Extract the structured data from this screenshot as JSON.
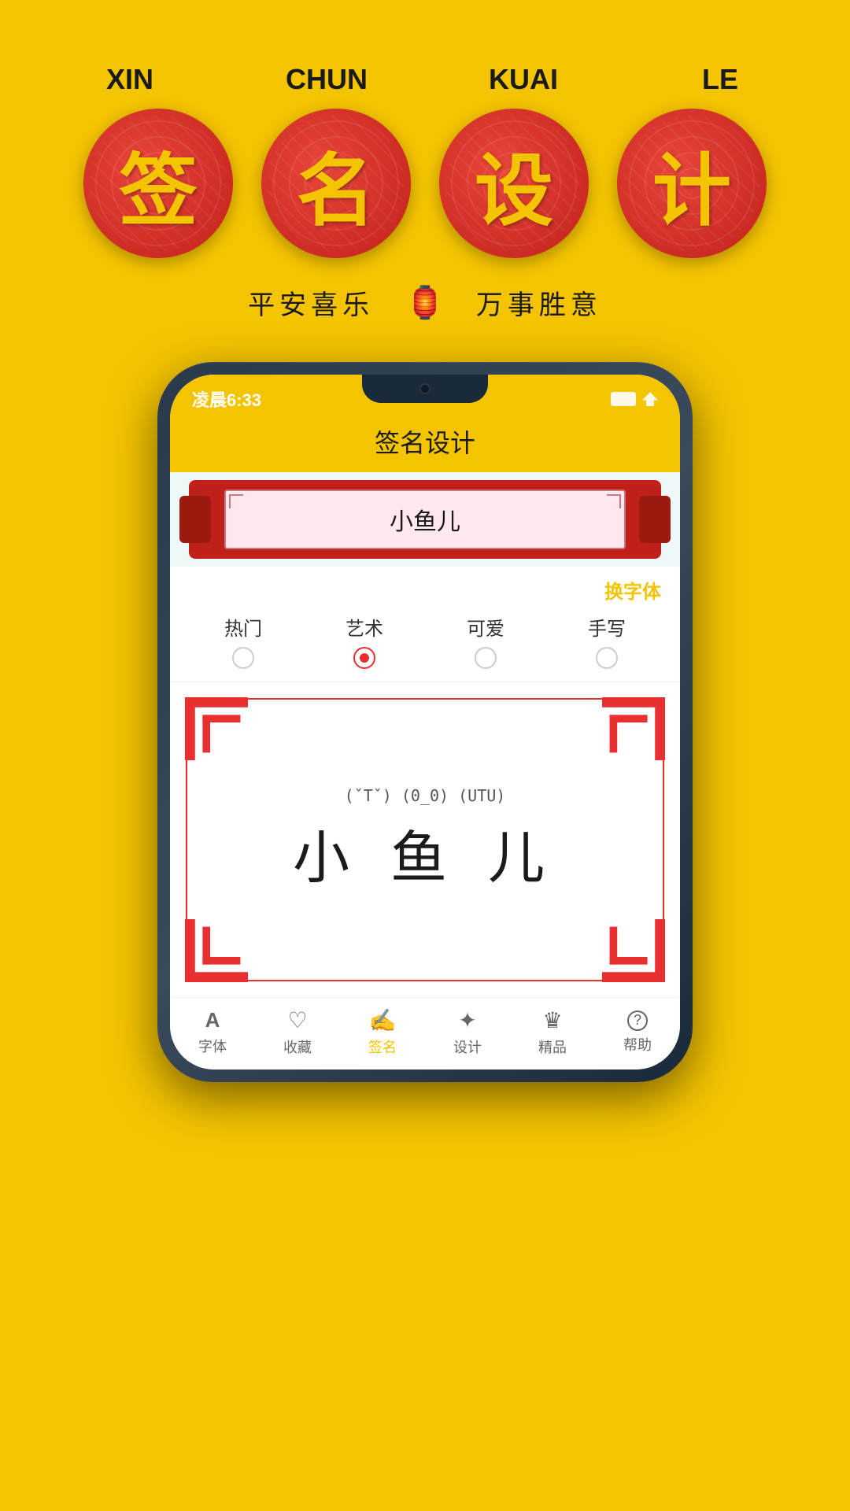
{
  "background_color": "#F5C400",
  "header": {
    "pinyin": [
      "XIN",
      "CHUN",
      "KUAI",
      "LE"
    ],
    "chars": [
      "签",
      "名",
      "设",
      "计"
    ],
    "subtitles": {
      "left": "平安喜乐",
      "right": "万事胜意",
      "icon": "🏮"
    }
  },
  "phone": {
    "status_bar": {
      "time": "凌晨6:33"
    },
    "title": "签名设计",
    "scroll": {
      "name": "小鱼儿"
    },
    "font_switch_label": "换字体",
    "font_tabs": [
      {
        "label": "热门",
        "active": false
      },
      {
        "label": "艺术",
        "active": true
      },
      {
        "label": "可爱",
        "active": false
      },
      {
        "label": "手写",
        "active": false
      }
    ],
    "signature": {
      "emoticons": "(ˇTˇ) (0_0) (UTU)",
      "name": "小 鱼 儿"
    },
    "bottom_nav": [
      {
        "icon": "A",
        "label": "字体",
        "active": false
      },
      {
        "icon": "♡",
        "label": "收藏",
        "active": false
      },
      {
        "icon": "✍",
        "label": "签名",
        "active": true
      },
      {
        "icon": "✦",
        "label": "设计",
        "active": false
      },
      {
        "icon": "★",
        "label": "精品",
        "active": false
      },
      {
        "icon": "?",
        "label": "帮助",
        "active": false
      }
    ]
  }
}
